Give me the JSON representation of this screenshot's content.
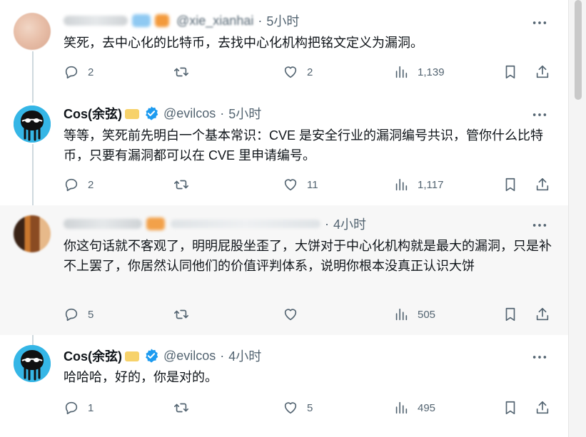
{
  "tweets": [
    {
      "author_name": "",
      "handle": "@xie_xianhai",
      "time": "5小时",
      "text": "笑死，去中心化的比特币，去找中心化机构把铭文定义为漏洞。",
      "replies": "2",
      "reposts": "",
      "likes": "2",
      "views": "1,139"
    },
    {
      "author_name": "Cos(余弦)",
      "handle": "@evilcos",
      "time": "5小时",
      "text": "等等，笑死前先明白一个基本常识：CVE 是安全行业的漏洞编号共识，管你什么比特币，只要有漏洞都可以在 CVE 里申请编号。",
      "replies": "2",
      "reposts": "",
      "likes": "11",
      "views": "1,117"
    },
    {
      "author_name": "",
      "handle": "",
      "time": "4小时",
      "text": "你这句话就不客观了，明明屁股坐歪了，大饼对于中心化机构就是最大的漏洞，只是补不上罢了，你居然认同他们的价值评判体系，说明你根本没真正认识大饼",
      "replies": "5",
      "reposts": "",
      "likes": "",
      "views": "505"
    },
    {
      "author_name": "Cos(余弦)",
      "handle": "@evilcos",
      "time": "4小时",
      "text": "哈哈哈，好的，你是对的。",
      "replies": "1",
      "reposts": "",
      "likes": "5",
      "views": "495"
    }
  ],
  "colors": {
    "text": "#0f1419",
    "muted": "#536471",
    "verified": "#1d9bf0",
    "highlight_bg": "#f7f7f7",
    "thread_line": "#cfd9de"
  },
  "icons": [
    "reply-icon",
    "repost-icon",
    "like-icon",
    "views-icon",
    "bookmark-icon",
    "share-icon",
    "more-icon",
    "verified-badge-icon"
  ]
}
